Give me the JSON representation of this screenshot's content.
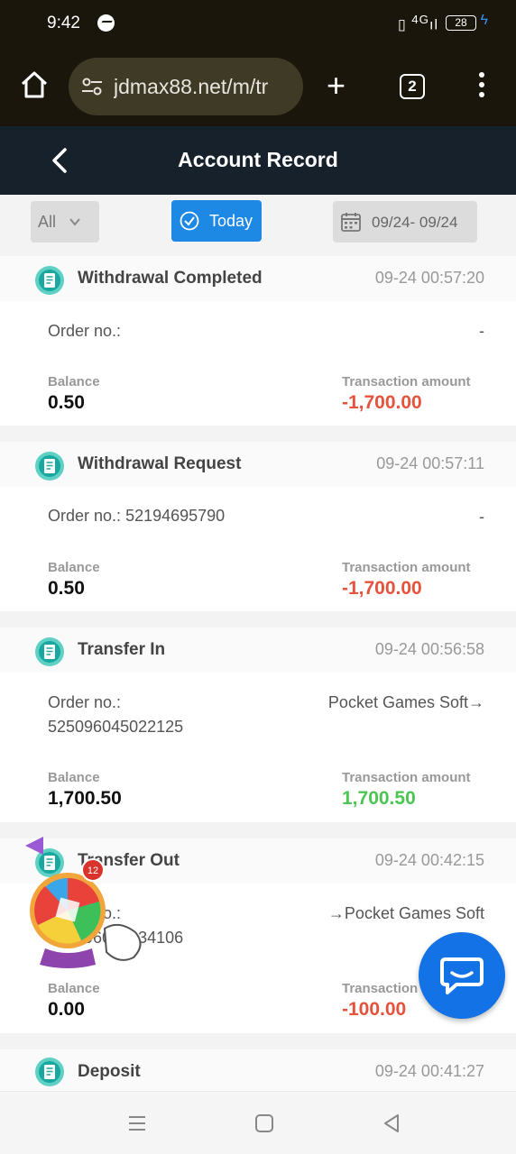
{
  "status_bar": {
    "time": "9:42",
    "signal_text": "4G",
    "battery": "28"
  },
  "browser": {
    "url": "jdmax88.net/m/tr",
    "tab_count": "2"
  },
  "header": {
    "title": "Account Record"
  },
  "filters": {
    "type": "All",
    "period": "Today",
    "date_range": "09/24- 09/24"
  },
  "labels": {
    "order": "Order no.:",
    "balance": "Balance",
    "amount": "Transaction amount"
  },
  "records": [
    {
      "type": "Withdrawal Completed",
      "time": "09-24 00:57:20",
      "order_no": "",
      "via": "-",
      "balance": "0.50",
      "amount": "-1,700.00"
    },
    {
      "type": "Withdrawal Request",
      "time": "09-24 00:57:11",
      "order_no": "52194695790",
      "via": "-",
      "balance": "0.50",
      "amount": "-1,700.00"
    },
    {
      "type": "Transfer In",
      "time": "09-24 00:56:58",
      "order_no": "525096045022125",
      "via": "Pocket Games Soft→",
      "balance": "1,700.50",
      "amount": "1,700.50"
    },
    {
      "type": "Transfer Out",
      "time": "09-24 00:42:15",
      "order_no": "525096045834106",
      "via": "→Pocket Games Soft",
      "balance": "0.00",
      "amount": "-100.00"
    },
    {
      "type": "Deposit",
      "time": "09-24 00:41:27"
    }
  ],
  "promo": {
    "badge": "12"
  },
  "colors": {
    "accent": "#1e88e5",
    "header_bg": "#16212c",
    "negative": "#e5533c",
    "positive": "#4cc552",
    "chat": "#1373e6"
  }
}
